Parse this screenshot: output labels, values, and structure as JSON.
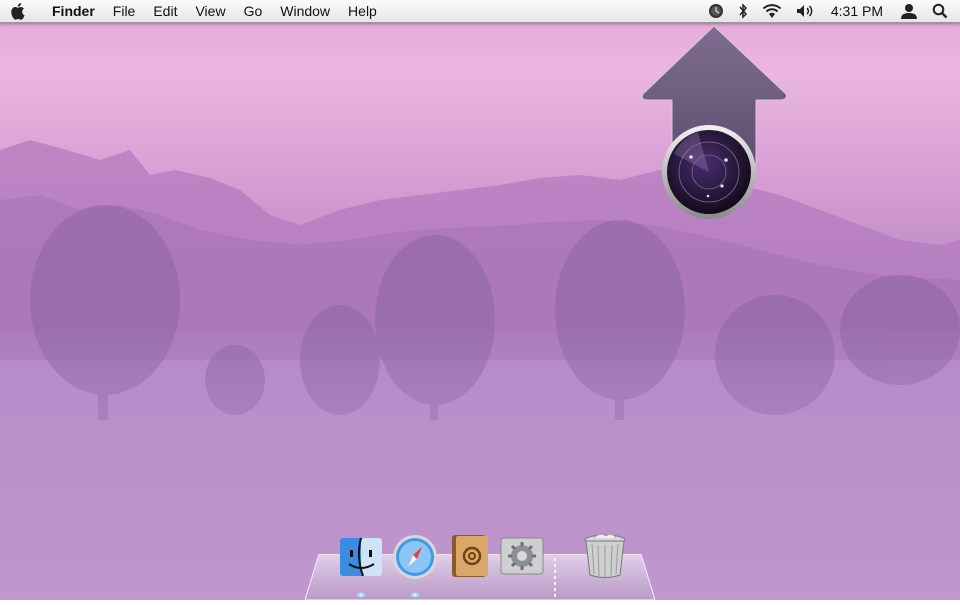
{
  "menubar": {
    "app_name": "Finder",
    "menus": [
      "File",
      "Edit",
      "View",
      "Go",
      "Window",
      "Help"
    ],
    "clock": "4:31 PM",
    "status_icons": [
      "time-machine-icon",
      "bluetooth-icon",
      "wifi-icon",
      "volume-icon",
      "user-icon",
      "spotlight-search-icon"
    ]
  },
  "desktop": {
    "wallpaper": "misty purple forest",
    "overlay": "upward arrow with radar badge"
  },
  "dock": {
    "items": [
      "finder-icon",
      "safari-icon",
      "address-book-icon",
      "system-preferences-icon",
      "stacks-divider",
      "trash-icon"
    ]
  },
  "colors": {
    "wallpaper_top": "#e3a6d6",
    "wallpaper_bottom": "#a67cba",
    "arrow": "#6c5d7c",
    "menubar": "#f2f2f2"
  }
}
